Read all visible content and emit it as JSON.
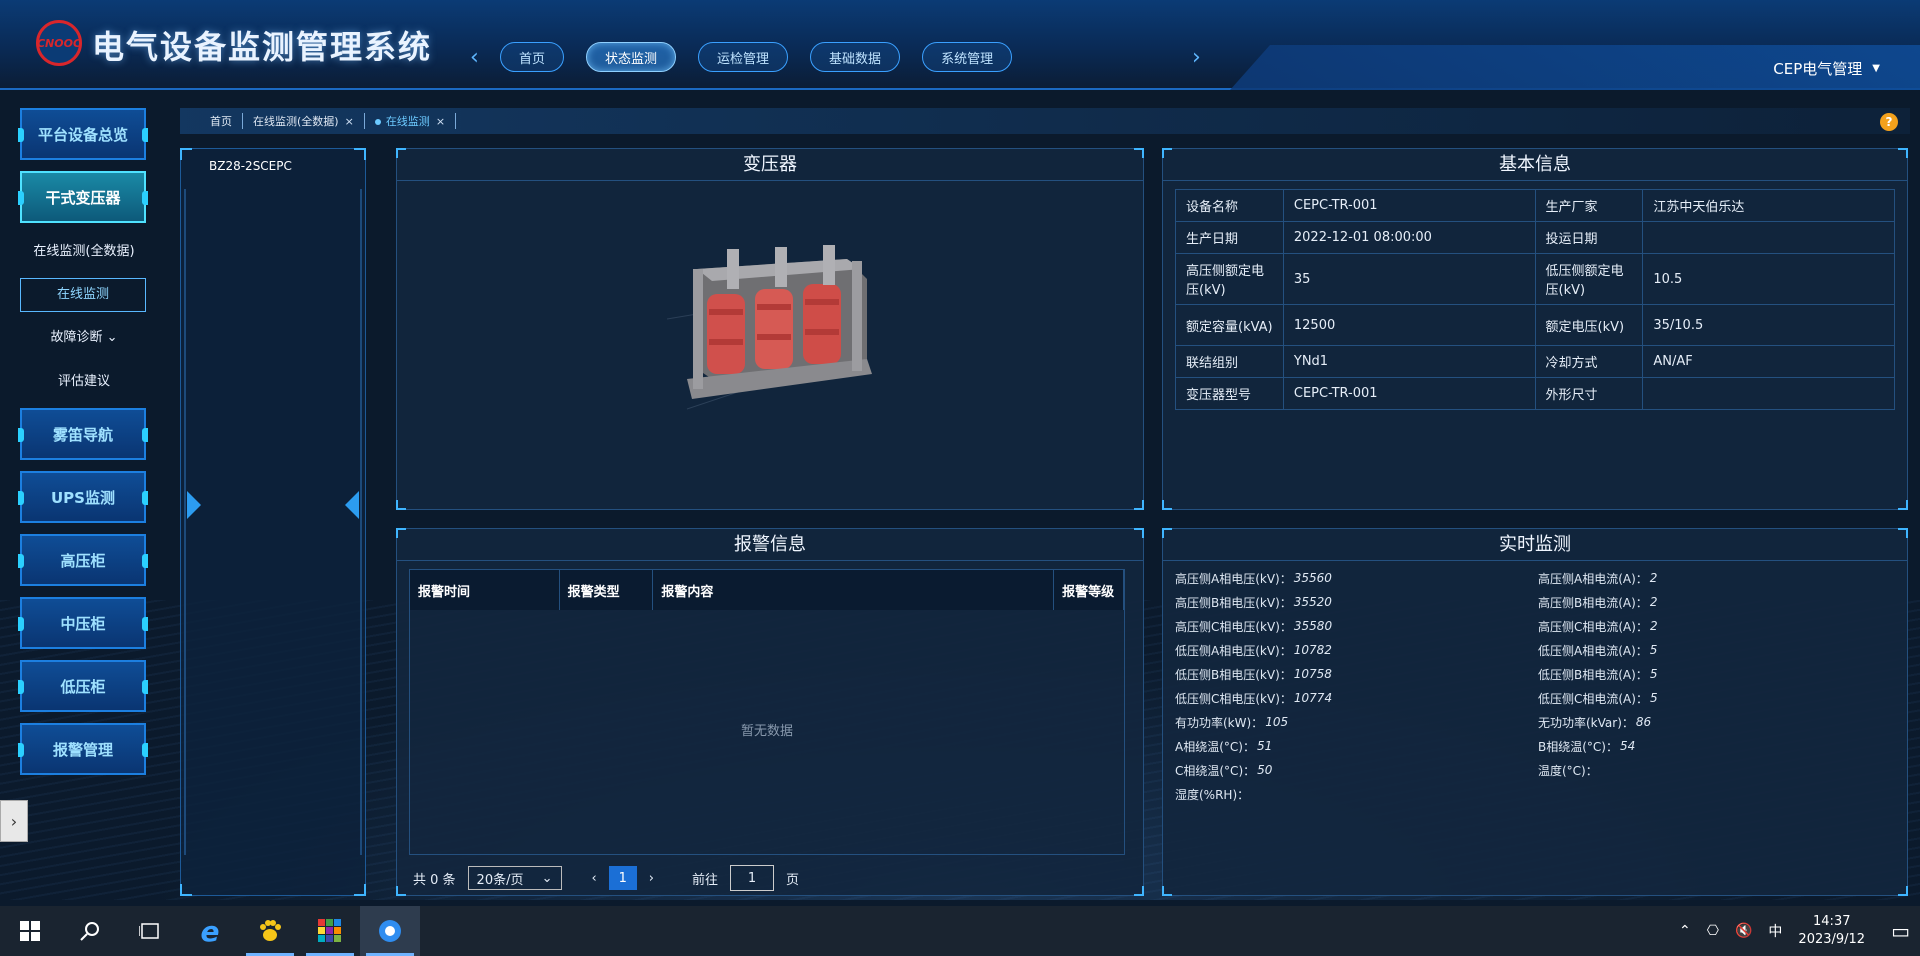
{
  "header": {
    "logo_text": "CNOOC",
    "title": "电气设备监测管理系统",
    "nav": [
      "首页",
      "状态监测",
      "运检管理",
      "基础数据",
      "系统管理"
    ],
    "nav_active": 1,
    "user": "CEP电气管理"
  },
  "sidebar": {
    "items": [
      {
        "label": "平台设备总览",
        "type": "btn"
      },
      {
        "label": "干式变压器",
        "type": "btn",
        "active": true
      },
      {
        "label": "在线监测(全数据)",
        "type": "sub"
      },
      {
        "label": "在线监测",
        "type": "subbox"
      },
      {
        "label": "故障诊断",
        "type": "sub",
        "chevron": true
      },
      {
        "label": "评估建议",
        "type": "sub"
      },
      {
        "label": "雾笛导航",
        "type": "btn"
      },
      {
        "label": "UPS监测",
        "type": "btn"
      },
      {
        "label": "高压柜",
        "type": "btn"
      },
      {
        "label": "中压柜",
        "type": "btn"
      },
      {
        "label": "低压柜",
        "type": "btn"
      },
      {
        "label": "报警管理",
        "type": "btn"
      }
    ]
  },
  "breadcrumbs": [
    {
      "label": "首页",
      "closable": false,
      "active": false
    },
    {
      "label": "在线监测(全数据)",
      "closable": true,
      "active": false
    },
    {
      "label": "在线监测",
      "closable": true,
      "active": true
    }
  ],
  "help_label": "?",
  "tree": {
    "item": "BZ28-2SCEPC"
  },
  "transformer_panel": {
    "title": "变压器"
  },
  "basic_info": {
    "title": "基本信息",
    "rows": [
      [
        "设备名称",
        "CEPC-TR-001",
        "生产厂家",
        "江苏中天伯乐达"
      ],
      [
        "生产日期",
        "2022-12-01 08:00:00",
        "投运日期",
        ""
      ],
      [
        "高压侧额定电压(kV)",
        "35",
        "低压侧额定电压(kV)",
        "10.5"
      ],
      [
        "额定容量(kVA)",
        "12500",
        "额定电压(kV)",
        "35/10.5"
      ],
      [
        "联结组别",
        "YNd1",
        "冷却方式",
        "AN/AF"
      ],
      [
        "变压器型号",
        "CEPC-TR-001",
        "外形尺寸",
        ""
      ]
    ]
  },
  "alarm": {
    "title": "报警信息",
    "columns": [
      "报警时间",
      "报警类型",
      "报警内容",
      "报警等级"
    ],
    "empty_text": "暂无数据",
    "pager": {
      "total": "共 0 条",
      "page_size": "20条/页",
      "current_page": "1",
      "goto_label": "前往",
      "goto_value": "1",
      "page_suffix": "页"
    }
  },
  "realtime": {
    "title": "实时监测",
    "items": [
      {
        "label": "高压侧A相电压(kV)：",
        "value": "35560"
      },
      {
        "label": "高压侧A相电流(A)：",
        "value": "2"
      },
      {
        "label": "高压侧B相电压(kV)：",
        "value": "35520"
      },
      {
        "label": "高压侧B相电流(A)：",
        "value": "2"
      },
      {
        "label": "高压侧C相电压(kV)：",
        "value": "35580"
      },
      {
        "label": "高压侧C相电流(A)：",
        "value": "2"
      },
      {
        "label": "低压侧A相电压(kV)：",
        "value": "10782"
      },
      {
        "label": "低压侧A相电流(A)：",
        "value": "5"
      },
      {
        "label": "低压侧B相电压(kV)：",
        "value": "10758"
      },
      {
        "label": "低压侧B相电流(A)：",
        "value": "5"
      },
      {
        "label": "低压侧C相电压(kV)：",
        "value": "10774"
      },
      {
        "label": "低压侧C相电流(A)：",
        "value": "5"
      },
      {
        "label": "有功功率(kW)：",
        "value": "105"
      },
      {
        "label": "无功功率(kVar)：",
        "value": "86"
      },
      {
        "label": "A相绕温(°C)：",
        "value": "51"
      },
      {
        "label": "B相绕温(°C)：",
        "value": "54"
      },
      {
        "label": "C相绕温(°C)：",
        "value": "50"
      },
      {
        "label": "温度(°C)：",
        "value": ""
      },
      {
        "label": "湿度(%RH)：",
        "value": ""
      }
    ]
  },
  "taskbar": {
    "ime": "中",
    "time": "14:37",
    "date": "2023/9/12"
  }
}
